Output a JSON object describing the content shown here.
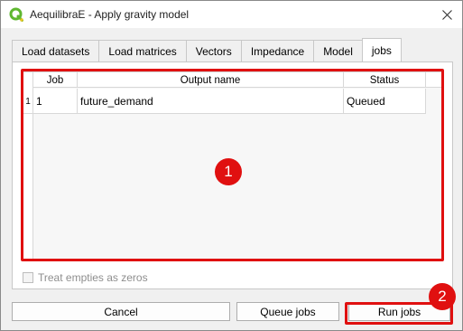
{
  "window": {
    "title": "AequilibraE - Apply gravity model"
  },
  "tabs": [
    {
      "label": "Load datasets",
      "active": false
    },
    {
      "label": "Load matrices",
      "active": false
    },
    {
      "label": "Vectors",
      "active": false
    },
    {
      "label": "Impedance",
      "active": false
    },
    {
      "label": "Model",
      "active": false
    },
    {
      "label": "jobs",
      "active": true
    }
  ],
  "table": {
    "columns": [
      "Job",
      "Output name",
      "Status"
    ],
    "rows": [
      {
        "row_header": "1",
        "job": "1",
        "output_name": "future_demand",
        "status": "Queued"
      }
    ]
  },
  "checkbox": {
    "label": "Treat empties as zeros",
    "checked": false,
    "enabled": false
  },
  "buttons": {
    "cancel": "Cancel",
    "queue": "Queue jobs",
    "run": "Run jobs"
  },
  "annotations": {
    "first": "1",
    "second": "2"
  },
  "colors": {
    "annotation": "#e01010",
    "qgis_green": "#5fb730"
  }
}
